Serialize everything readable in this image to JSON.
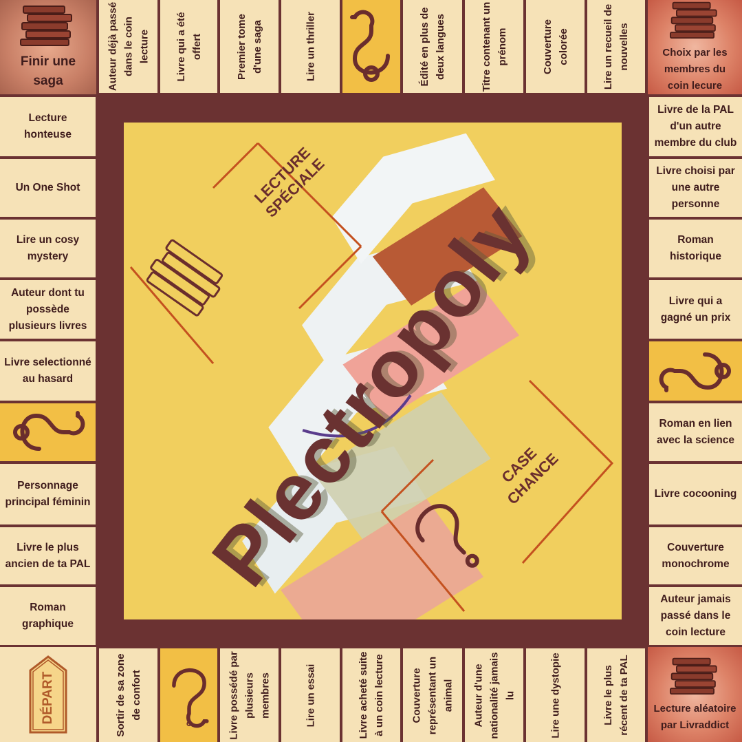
{
  "title": "Plectropoly",
  "corners": {
    "top_left": "Finir une saga",
    "top_right": "Choix par les membres du coin lecure",
    "bottom_left": "DÉPART",
    "bottom_right": "Lecture aléatoire par Livraddict"
  },
  "top_row": [
    "Auteur déjà passé dans le coin lecture",
    "Livre qui a été offert",
    "Premier tome d'une saga",
    "Lire un thriller",
    "?",
    "Édité en plus de deux langues",
    "Titre contenant un prénom",
    "Couverture colorée",
    "Lire un recueil de nouvelles"
  ],
  "left_column": [
    "Lecture honteuse",
    "Un One Shot",
    "Lire un cosy mystery",
    "Auteur dont tu possède plusieurs livres",
    "Livre selectionné au hasard",
    "?",
    "Personnage principal féminin",
    "Livre le plus ancien de ta PAL",
    "Roman graphique"
  ],
  "right_column": [
    "Livre de la PAL d'un autre membre du club",
    "Livre choisi par une autre personne",
    "Roman historique",
    "Livre qui a gagné un prix",
    "?",
    "Roman en lien avec la science",
    "Livre cocooning",
    "Couverture monochrome",
    "Auteur jamais passé dans le coin lecture"
  ],
  "bottom_row": [
    "Sortir de sa zone de confort",
    "?",
    "Livre possédé par plusieurs membres",
    "Lire un essai",
    "Livre acheté suite à un coin lecture",
    "Couverture représentant un animal",
    "Auteur d'une nationalité jamais lu",
    "Lire une dystopie",
    "Livre le plus récent de ta PAL"
  ],
  "center": {
    "special_card_line1": "LECTURE",
    "special_card_line2": "SPÉCIALE",
    "chance_card_line1": "CASE",
    "chance_card_line2": "CHANCE",
    "chance_symbol": "?"
  },
  "colors": {
    "board_border": "#6b3232",
    "cell": "#f6e2b7",
    "chance_cell": "#f2bf45",
    "center": "#f1cf5e",
    "accent_orange": "#c4511f",
    "title": "#6a3231"
  }
}
